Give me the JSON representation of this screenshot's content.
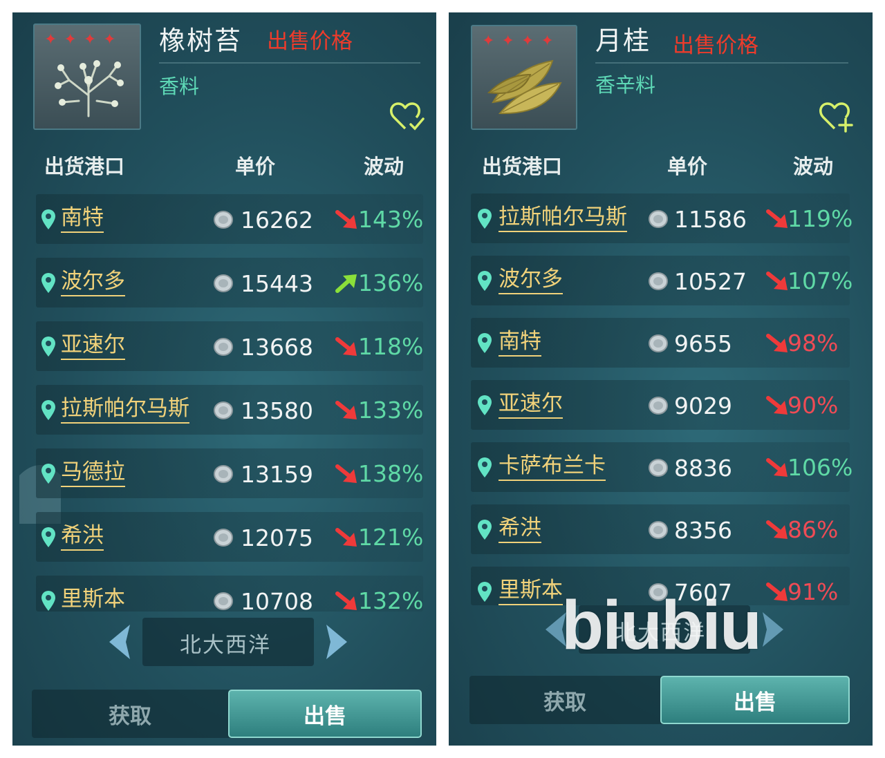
{
  "left": {
    "item_name": "橡树苔",
    "price_label": "出售价格",
    "category": "香料",
    "stars": [
      "✦",
      "✦",
      "✦",
      "✦"
    ],
    "fav_icon": "heart-check-icon",
    "columns": {
      "port": "出货港口",
      "price": "单价",
      "change": "波动"
    },
    "rows": [
      {
        "port": "南特",
        "price": "16262",
        "change": "143%",
        "trend": "down"
      },
      {
        "port": "波尔多",
        "price": "15443",
        "change": "136%",
        "trend": "up"
      },
      {
        "port": "亚速尔",
        "price": "13668",
        "change": "118%",
        "trend": "down"
      },
      {
        "port": "拉斯帕尔马斯",
        "price": "13580",
        "change": "133%",
        "trend": "down"
      },
      {
        "port": "马德拉",
        "price": "13159",
        "change": "138%",
        "trend": "down"
      },
      {
        "port": "希洪",
        "price": "12075",
        "change": "121%",
        "trend": "down"
      },
      {
        "port": "里斯本",
        "price": "10708",
        "change": "132%",
        "trend": "down"
      }
    ],
    "region": "北大西洋",
    "tab_get": "获取",
    "tab_sell": "出售"
  },
  "right": {
    "item_name": "月桂",
    "price_label": "出售价格",
    "category": "香辛料",
    "stars": [
      "✦",
      "✦",
      "✦",
      "✦"
    ],
    "fav_icon": "heart-plus-icon",
    "columns": {
      "port": "出货港口",
      "price": "单价",
      "change": "波动"
    },
    "rows": [
      {
        "port": "拉斯帕尔马斯",
        "price": "11586",
        "change": "119%",
        "trend": "down"
      },
      {
        "port": "波尔多",
        "price": "10527",
        "change": "107%",
        "trend": "down"
      },
      {
        "port": "南特",
        "price": "9655",
        "change": "98%",
        "trend": "down"
      },
      {
        "port": "亚速尔",
        "price": "9029",
        "change": "90%",
        "trend": "down"
      },
      {
        "port": "卡萨布兰卡",
        "price": "8836",
        "change": "106%",
        "trend": "down"
      },
      {
        "port": "希洪",
        "price": "8356",
        "change": "86%",
        "trend": "down"
      },
      {
        "port": "里斯本",
        "price": "7607",
        "change": "91%",
        "trend": "down"
      }
    ],
    "region": "北大西洋",
    "tab_get": "获取",
    "tab_sell": "出售"
  },
  "watermark": "biubiu",
  "colors": {
    "star": "#e03b3b",
    "price_label": "#ee3b2b",
    "category": "#5ed8b6",
    "port": "#f1d27a",
    "pct_above_100": "#5fd9a6",
    "pct_below_100": "#ef4b55",
    "arrow_down": "#ef3a3a",
    "arrow_up": "#8be03a"
  }
}
